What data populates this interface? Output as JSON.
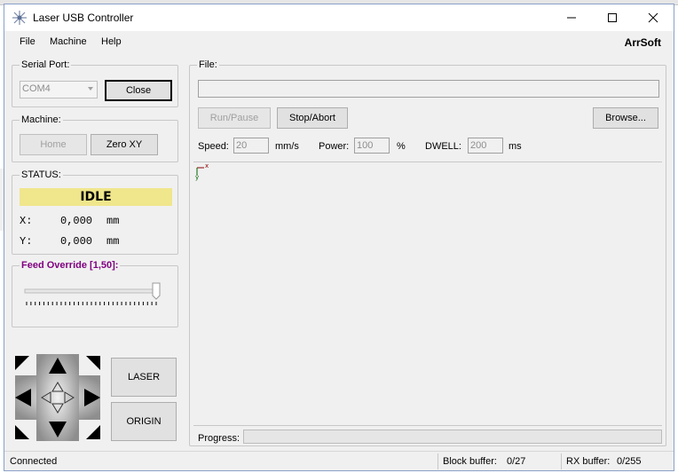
{
  "window": {
    "title": "Laser USB Controller"
  },
  "menu": {
    "file": "File",
    "machine": "Machine",
    "help": "Help",
    "brand": "ArrSoft"
  },
  "serial": {
    "label": "Serial Port:",
    "port": "COM4",
    "close_label": "Close"
  },
  "machine": {
    "label": "Machine:",
    "home_label": "Home",
    "zero_label": "Zero XY"
  },
  "status": {
    "label": "STATUS:",
    "state": "IDLE",
    "x_label": "X:",
    "x_value": "0,000",
    "y_label": "Y:",
    "y_value": "0,000",
    "unit": "mm"
  },
  "feed": {
    "label": "Feed Override [1,50]:",
    "level": 1.0
  },
  "jog": {
    "laser_label": "LASER",
    "origin_label": "ORIGIN"
  },
  "file_panel": {
    "label": "File:",
    "path": "",
    "run_label": "Run/Pause",
    "stop_label": "Stop/Abort",
    "browse_label": "Browse...",
    "speed_label": "Speed:",
    "speed_value": "20",
    "speed_unit": "mm/s",
    "power_label": "Power:",
    "power_value": "100",
    "power_unit": "%",
    "dwell_label": "DWELL:",
    "dwell_value": "200",
    "dwell_unit": "ms",
    "axis_x": "x",
    "axis_y": "y",
    "progress_label": "Progress:",
    "progress": 0
  },
  "statusbar": {
    "connection": "Connected",
    "block_label": "Block buffer:",
    "block_value": "0/27",
    "rx_label": "RX buffer:",
    "rx_value": "0/255"
  },
  "colors": {
    "idle_bg": "#f0e68c",
    "feed_label": "#800080",
    "jog_pad": "#a8a8a8"
  }
}
